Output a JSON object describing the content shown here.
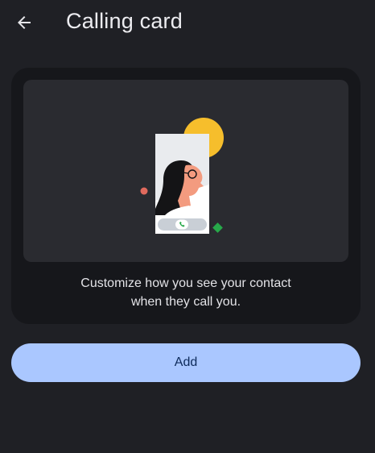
{
  "header": {
    "back_icon": "arrow-left-icon",
    "title": "Calling card"
  },
  "card": {
    "illustration": "woman-on-call-illustration",
    "description_line1": "Customize how you see your contact",
    "description_line2": "when they call you."
  },
  "actions": {
    "add_label": "Add"
  },
  "colors": {
    "background": "#1f2025",
    "card": "#16171b",
    "illustration_bg": "#2a2b30",
    "button": "#aac7ff",
    "button_text": "#0d2a5a",
    "sun": "#f6be2c",
    "accent_green": "#27a94a",
    "accent_red": "#e06a5d"
  }
}
